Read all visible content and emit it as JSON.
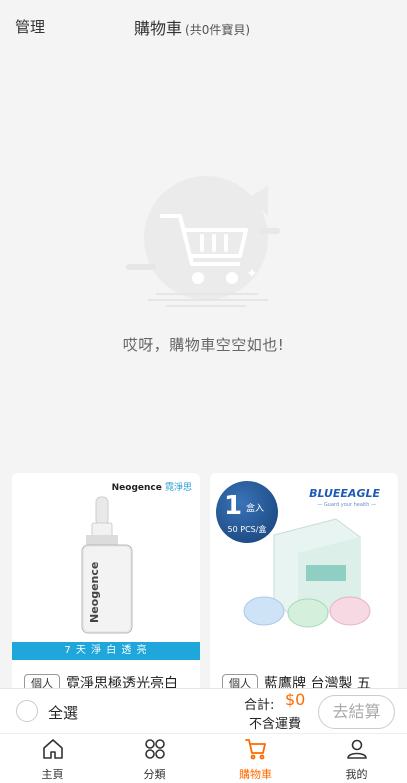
{
  "header": {
    "manage_label": "管理",
    "title": "購物車",
    "count_text": "(共0件寶貝)"
  },
  "empty": {
    "message": "哎呀，購物車空空如也!",
    "icon": "empty-cart-icon"
  },
  "recommendations": [
    {
      "brand": "Neogence",
      "brand_cn": "霓淨思",
      "promo_text": "7 天 淨 白 透 亮",
      "badge": "個人",
      "title": "霓淨思極透光亮白"
    },
    {
      "brand": "BLUEEAGLE",
      "brand_sub": "— Guard your health —",
      "qty_num": "1",
      "qty_unit": "盒入",
      "qty_pcs": "50 PCS/盒",
      "badge": "個人",
      "title": "藍鷹牌 台灣製 五"
    }
  ],
  "bottom_bar": {
    "select_all": "全選",
    "total_label": "合計:",
    "total_value": "$0",
    "shipping": "不含運費",
    "checkout": "去結算"
  },
  "tabs": [
    {
      "label": "主頁",
      "icon": "home-icon",
      "active": false
    },
    {
      "label": "分類",
      "icon": "category-icon",
      "active": false
    },
    {
      "label": "購物車",
      "icon": "cart-icon",
      "active": true
    },
    {
      "label": "我的",
      "icon": "user-icon",
      "active": false
    }
  ],
  "colors": {
    "accent": "#ff6a00",
    "promo_bar": "#1fa7dc",
    "background": "#f4f4f4"
  }
}
